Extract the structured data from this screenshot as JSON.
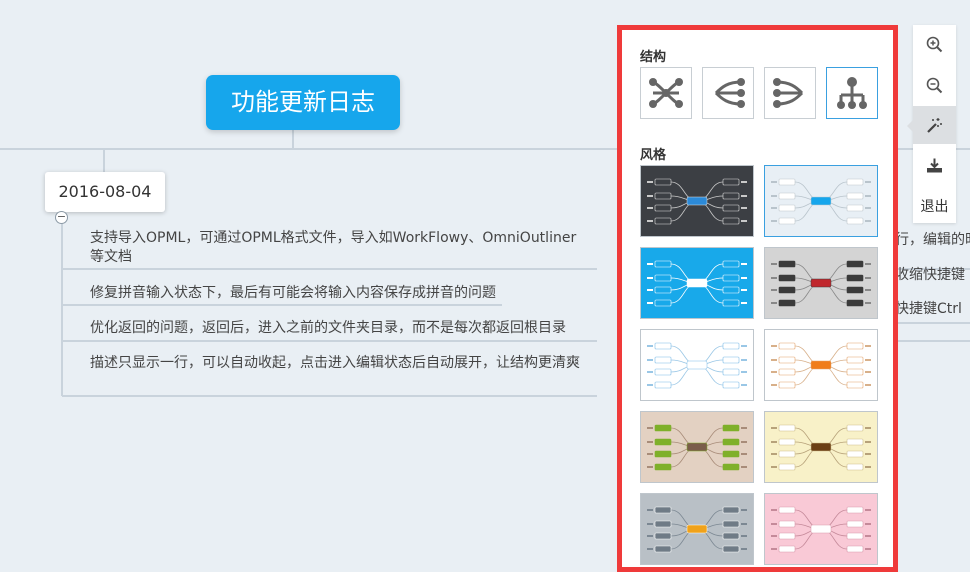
{
  "mindmap": {
    "root_title": "功能更新日志",
    "date_node": "2016-08-04",
    "collapse_symbol": "−",
    "leaves": [
      {
        "text": "支持导入OPML，可通过OPML格式文件，导入如WorkFlowy、OmniOutliner等文档"
      },
      {
        "text": "修复拼音输入状态下，最后有可能会将输入内容保存成拼音的问题"
      },
      {
        "text": "优化返回的问题，返回后，进入之前的文件夹目录，而不是每次都返回根目录"
      },
      {
        "text": "描述只显示一行，可以自动收起，点击进入编辑状态后自动展开，让结构更清爽"
      }
    ],
    "right_fragments": [
      "行，编辑的时",
      "收缩快捷键",
      "快捷键Ctrl"
    ]
  },
  "panel": {
    "structure_title": "结构",
    "style_title": "风格",
    "structures": [
      {
        "name": "mindmap-both-sides",
        "icon": "structure-mindmap-icon"
      },
      {
        "name": "logic-left",
        "icon": "structure-logic-left-icon"
      },
      {
        "name": "logic-right",
        "icon": "structure-logic-right-icon"
      },
      {
        "name": "org-chart",
        "icon": "structure-org-chart-icon",
        "selected": true
      }
    ],
    "styles": [
      {
        "bg": "#3c3f44",
        "center": "#2c8ad8",
        "line": "#c9c9c9",
        "node": "#3c3f44",
        "nodeBorder": "#e0e0e0",
        "text": "#ffffff",
        "selected": false
      },
      {
        "bg": "#e8eff5",
        "center": "#16a6ec",
        "line": "#b9c4cc",
        "node": "#ffffff",
        "nodeBorder": "#c0c8ce",
        "text": "#555555",
        "selected": true
      },
      {
        "bg": "#18a9ea",
        "center": "#ffffff",
        "line": "#ffffff",
        "node": "#18a9ea",
        "nodeBorder": "#ffffff",
        "text": "#ffffff",
        "selected": false
      },
      {
        "bg": "#d4d4d4",
        "center": "#c0272d",
        "line": "#888888",
        "node": "#3a3a3a",
        "nodeBorder": "#3a3a3a",
        "text": "#ffffff",
        "selected": false
      },
      {
        "bg": "#ffffff",
        "center": "#ffffff",
        "line": "#9ac7e6",
        "node": "#ffffff",
        "nodeBorder": "#7fbde8",
        "text": "#3c8fcf",
        "selected": false
      },
      {
        "bg": "#ffffff",
        "center": "#f07d1a",
        "line": "#d8b08a",
        "node": "#ffffff",
        "nodeBorder": "#e4a36b",
        "text": "#c86412",
        "selected": false
      },
      {
        "bg": "#e3d1c2",
        "center": "#7a5d4a",
        "line": "#a88c79",
        "node": "#7fb02a",
        "nodeBorder": "#7fb02a",
        "text": "#ffffff",
        "selected": false
      },
      {
        "bg": "#f8f1c8",
        "center": "#6b3e14",
        "line": "#b7a27a",
        "node": "#ffffff",
        "nodeBorder": "#cfc08c",
        "text": "#6b3e14",
        "selected": false
      },
      {
        "bg": "#b9c0c6",
        "center": "#f0a21a",
        "line": "#7c8893",
        "node": "#6f7b86",
        "nodeBorder": "#ffffff",
        "text": "#ffffff",
        "selected": false
      },
      {
        "bg": "#f9c9d6",
        "center": "#ffffff",
        "line": "#c58a9a",
        "node": "#ffffff",
        "nodeBorder": "#d99aab",
        "text": "#8a4a5a",
        "selected": false
      }
    ]
  },
  "toolbar": {
    "tools": [
      {
        "name": "zoom-in",
        "icon": "zoom-in-icon"
      },
      {
        "name": "zoom-out",
        "icon": "zoom-out-icon"
      },
      {
        "name": "style",
        "icon": "magic-wand-icon",
        "active": true
      },
      {
        "name": "export",
        "icon": "download-icon"
      }
    ],
    "exit_label": "退出"
  }
}
